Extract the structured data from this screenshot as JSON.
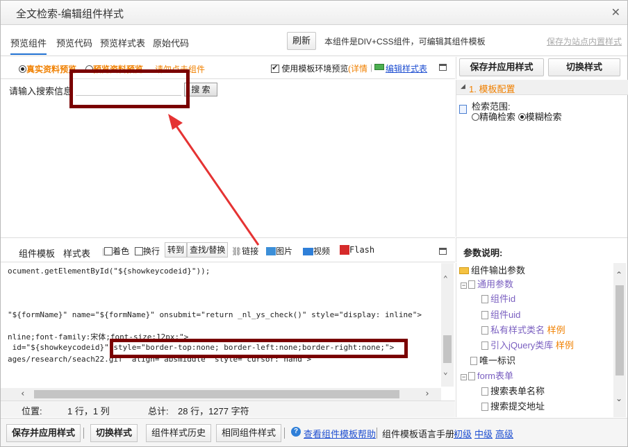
{
  "window": {
    "title": "全文检索-编辑组件样式"
  },
  "tabs": [
    "预览组件",
    "预览代码",
    "预览样式表",
    "原始代码"
  ],
  "header": {
    "refresh_label": "刷新",
    "description": "本组件是DIV+CSS组件，可编辑其组件模板",
    "save_site_label": "保存为站点内置样式"
  },
  "preview_bar": {
    "real_preview": "真实资料预览",
    "sample_preview": "预览资料预览",
    "click_hint": "请勿点击组件",
    "use_env_label": "使用模板环境预览",
    "details_label": "(详情",
    "edit_css_label": "编辑样式表"
  },
  "preview": {
    "search_label": "请输入搜索信息",
    "search_button": "搜 索"
  },
  "right_panel": {
    "save_apply": "保存并应用样式",
    "switch_style": "切换样式",
    "config_head": "1. 模板配置",
    "search_range_label": "检索范围:",
    "exact_label": "精确检索",
    "fuzzy_label": "模糊检索",
    "params_title": "参数说明:",
    "tree": [
      {
        "label": "组件输出参数",
        "type": "folder",
        "indent": 0
      },
      {
        "label": "通用参数",
        "type": "group",
        "indent": 1,
        "color": "purple"
      },
      {
        "label": "组件id",
        "type": "file",
        "indent": 2,
        "color": "purple"
      },
      {
        "label": "组件uid",
        "type": "file",
        "indent": 2,
        "color": "purple"
      },
      {
        "label": "私有样式类名",
        "extra": "样例",
        "type": "file",
        "indent": 2,
        "color": "purple"
      },
      {
        "label": "引入jQuery类库",
        "extra": "样例",
        "type": "file",
        "indent": 2,
        "color": "purple"
      },
      {
        "label": "唯一标识",
        "type": "file",
        "indent": 1
      },
      {
        "label": "form表单",
        "type": "group",
        "indent": 1,
        "color": "purple"
      },
      {
        "label": "搜索表单名称",
        "type": "file",
        "indent": 2
      },
      {
        "label": "搜索提交地址",
        "type": "file",
        "indent": 2
      }
    ]
  },
  "editor": {
    "tab_template": "组件模板",
    "tab_css": "样式表",
    "color_label": "着色",
    "wrap_label": "换行",
    "goto_label": "转到",
    "find_label": "查找/替换",
    "link_label": "链接",
    "image_label": "图片",
    "video_label": "视频",
    "flash_label": "Flash",
    "code_lines": [
      "ocument.getElementById(\"${showkeycodeid}\"));",
      "",
      "",
      "\"${formName}\" name=\"${formName}\" onsubmit=\"return _nl_ys_check()\" style=\"display: inline\">",
      "",
      "nline;font-family:宋体;font-size:12px;\">",
      " id=\"${showkeycodeid}\" style=\"border-top:none; border-left:none;border-right:none;\">",
      "ages/research/seach22.gif\" align=\"absmiddle\" style=\"cursor: hand\">"
    ]
  },
  "status": {
    "pos_label": "位置:",
    "pos_value": "1 行，1 列",
    "total_label": "总计:",
    "total_value": "28 行，1277 字符"
  },
  "bottom": {
    "save_apply": "保存并应用样式",
    "switch_style": "切换样式",
    "history": "组件样式历史",
    "same_style": "相同组件样式",
    "help_link": "查看组件模板帮助",
    "manual_label": "组件模板语言手册:",
    "level_basic": "初级",
    "level_mid": "中级",
    "level_high": "高级"
  },
  "colors": {
    "annotation": "#7a0000",
    "arrow": "#e53333",
    "accent": "#1f6fd1",
    "orange": "#f08000"
  }
}
